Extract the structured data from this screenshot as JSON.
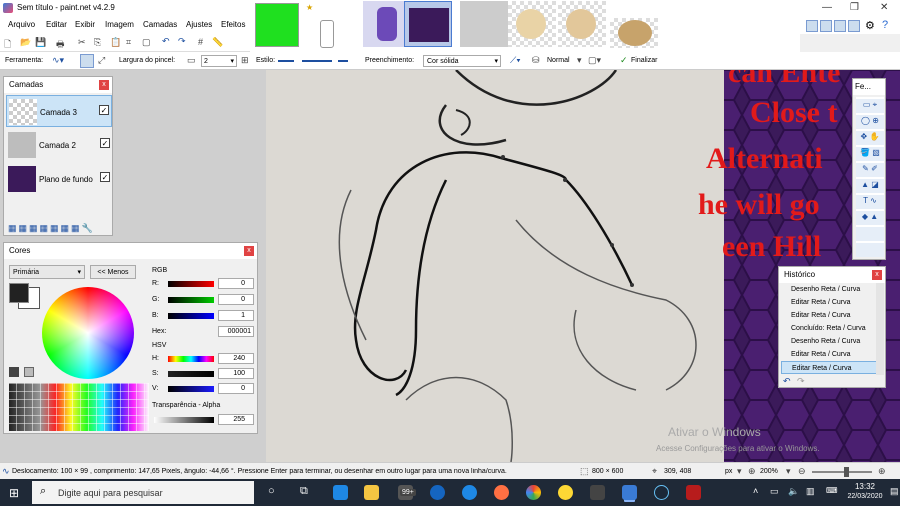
{
  "window": {
    "title": "Sem título - paint.net v4.2.9"
  },
  "menu": [
    "Arquivo",
    "Editar",
    "Exibir",
    "Imagem",
    "Camadas",
    "Ajustes",
    "Efeitos"
  ],
  "toolbar": {
    "tool_label": "Ferramenta:",
    "brush_width_label": "Largura do pincel:",
    "brush_width_value": "2",
    "style_label": "Estilo:",
    "fill_label": "Preenchimento:",
    "fill_value": "Cor sólida",
    "blend_value": "Normal",
    "finish_label": "Finalizar"
  },
  "layers_panel": {
    "title": "Camadas",
    "layers": [
      {
        "name": "Camada 3",
        "visible": true,
        "selected": true
      },
      {
        "name": "Camada 2",
        "visible": true,
        "selected": false
      },
      {
        "name": "Plano de fundo",
        "visible": true,
        "selected": false
      }
    ]
  },
  "colors_panel": {
    "title": "Cores",
    "mode": "Primária",
    "less_button": "<< Menos",
    "rgb_label": "RGB",
    "r_label": "R:",
    "r": "0",
    "g_label": "G:",
    "g": "0",
    "b_label": "B:",
    "b": "1",
    "hex_label": "Hex:",
    "hex": "000001",
    "hsv_label": "HSV",
    "h_label": "H:",
    "h": "240",
    "s_label": "S:",
    "s": "100",
    "v_label": "V:",
    "v": "0",
    "alpha_label": "Transparência - Alpha",
    "alpha": "255",
    "primary_color": "#222222",
    "secondary_color": "#ffffff"
  },
  "history_panel": {
    "title": "Histórico",
    "items": [
      "Desenho Reta / Curva",
      "Editar Reta / Curva",
      "Editar Reta / Curva",
      "Concluído: Reta / Curva",
      "Desenho Reta / Curva",
      "Editar Reta / Curva",
      "Editar Reta / Curva"
    ]
  },
  "tools_panel": {
    "title": "Fe..."
  },
  "canvas_text": [
    "can Ente",
    "Close t",
    "Alternati",
    "he will go",
    "een Hill"
  ],
  "watermark": {
    "line1": "Ativar o Windows",
    "line2": "Acesse Configurações para ativar o Windows."
  },
  "status": {
    "message": "Deslocamento: 100 × 99 , comprimento: 147,65 Pixels, ângulo: -44,66 °. Pressione Enter para terminar, ou desenhar em outro lugar para uma nova linha/curva.",
    "size": "800 × 600",
    "cursor": "309, 408",
    "unit": "px",
    "zoom": "200%"
  },
  "taskbar": {
    "search_placeholder": "Digite aqui para pesquisar",
    "badge": "99+",
    "time": "13:32",
    "date": "22/03/2020"
  },
  "icons": [
    "paint-net-icon",
    "save-icon",
    "undo-icon",
    "redo-icon",
    "grid-icon",
    "close-icon",
    "settings-icon",
    "search-icon",
    "windows-start-icon",
    "chevron-up-icon"
  ]
}
